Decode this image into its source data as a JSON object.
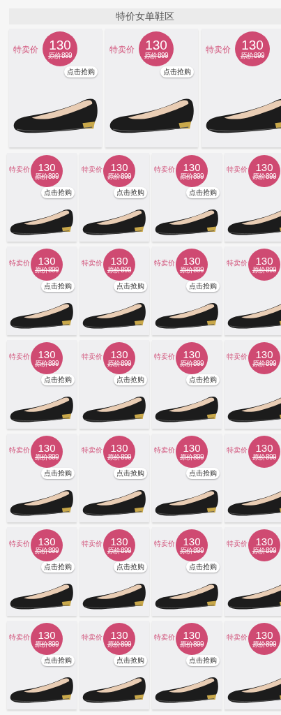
{
  "title": "特价女单鞋区",
  "featured": [
    {
      "label": "特卖价",
      "price": "130",
      "original_price": "原价899",
      "buy_label": "点击抢购"
    },
    {
      "label": "特卖价",
      "price": "130",
      "original_price": "原价899",
      "buy_label": "点击抢购"
    },
    {
      "label": "特卖价",
      "price": "130",
      "original_price": "原价899"
    }
  ],
  "grid_rows": [
    [
      {
        "label": "特卖价",
        "price": "130",
        "original_price": "原价899",
        "buy_label": "点击抢购"
      },
      {
        "label": "特卖价",
        "price": "130",
        "original_price": "原价899",
        "buy_label": "点击抢购"
      },
      {
        "label": "特卖价",
        "price": "130",
        "original_price": "原价899",
        "buy_label": "点击抢购"
      },
      {
        "label": "特卖价",
        "price": "130",
        "original_price": "原价899"
      }
    ],
    [
      {
        "label": "特卖价",
        "price": "130",
        "original_price": "原价899",
        "buy_label": "点击抢购"
      },
      {
        "label": "特卖价",
        "price": "130",
        "original_price": "原价899",
        "buy_label": "点击抢购"
      },
      {
        "label": "特卖价",
        "price": "130",
        "original_price": "原价899",
        "buy_label": "点击抢购"
      },
      {
        "label": "特卖价",
        "price": "130",
        "original_price": "原价899"
      }
    ],
    [
      {
        "label": "特卖价",
        "price": "130",
        "original_price": "原价899",
        "buy_label": "点击抢购"
      },
      {
        "label": "特卖价",
        "price": "130",
        "original_price": "原价899",
        "buy_label": "点击抢购"
      },
      {
        "label": "特卖价",
        "price": "130",
        "original_price": "原价899",
        "buy_label": "点击抢购"
      },
      {
        "label": "特卖价",
        "price": "130",
        "original_price": "原价899"
      }
    ],
    [
      {
        "label": "特卖价",
        "price": "130",
        "original_price": "原价899",
        "buy_label": "点击抢购"
      },
      {
        "label": "特卖价",
        "price": "130",
        "original_price": "原价899",
        "buy_label": "点击抢购"
      },
      {
        "label": "特卖价",
        "price": "130",
        "original_price": "原价899",
        "buy_label": "点击抢购"
      },
      {
        "label": "特卖价",
        "price": "130",
        "original_price": "原价899"
      }
    ],
    [
      {
        "label": "特卖价",
        "price": "130",
        "original_price": "原价899",
        "buy_label": "点击抢购"
      },
      {
        "label": "特卖价",
        "price": "130",
        "original_price": "原价899",
        "buy_label": "点击抢购"
      },
      {
        "label": "特卖价",
        "price": "130",
        "original_price": "原价899",
        "buy_label": "点击抢购"
      },
      {
        "label": "特卖价",
        "price": "130",
        "original_price": "原价899"
      }
    ],
    [
      {
        "label": "特卖价",
        "price": "130",
        "original_price": "原价899",
        "buy_label": "点击抢购"
      },
      {
        "label": "特卖价",
        "price": "130",
        "original_price": "原价899",
        "buy_label": "点击抢购"
      },
      {
        "label": "特卖价",
        "price": "130",
        "original_price": "原价899",
        "buy_label": "点击抢购"
      },
      {
        "label": "特卖价",
        "price": "130",
        "original_price": "原价899"
      }
    ]
  ]
}
